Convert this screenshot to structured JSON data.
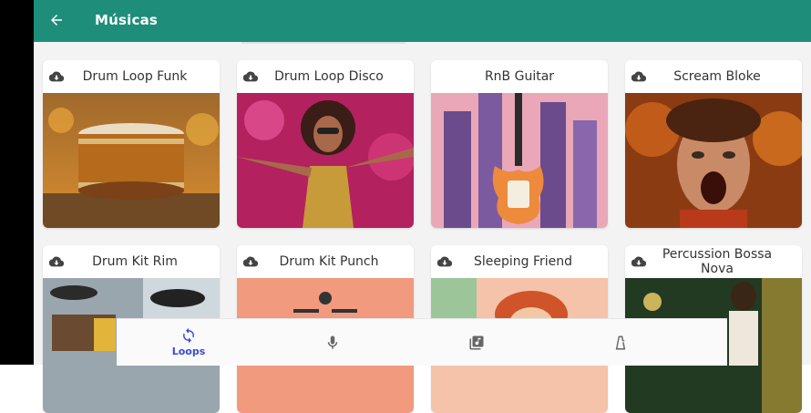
{
  "appbar": {
    "title": "Músicas",
    "back_icon": "arrow-left-icon",
    "color": "#1e8e7a"
  },
  "cards": [
    {
      "name": "Drum Loop Funk",
      "icon": "cloud-download-icon"
    },
    {
      "name": "Drum Loop Disco",
      "icon": "cloud-download-icon"
    },
    {
      "name": "RnB Guitar",
      "icon": "cloud-download-icon"
    },
    {
      "name": "Scream Bloke",
      "icon": "cloud-download-icon"
    },
    {
      "name": "Drum Kit Rim",
      "icon": "cloud-download-icon"
    },
    {
      "name": "Drum Kit Punch",
      "icon": "cloud-download-icon"
    },
    {
      "name": "Sleeping Friend",
      "icon": "cloud-download-icon"
    },
    {
      "name": "Percussion Bossa Nova",
      "icon": "cloud-download-icon"
    }
  ],
  "bottom_nav": {
    "active_color": "#3b49d8",
    "items": [
      {
        "label": "Loops",
        "icon": "loop-icon",
        "active": true
      },
      {
        "label": "",
        "icon": "microphone-icon",
        "active": false
      },
      {
        "label": "",
        "icon": "music-library-icon",
        "active": false
      },
      {
        "label": "",
        "icon": "metronome-icon",
        "active": false
      }
    ]
  }
}
